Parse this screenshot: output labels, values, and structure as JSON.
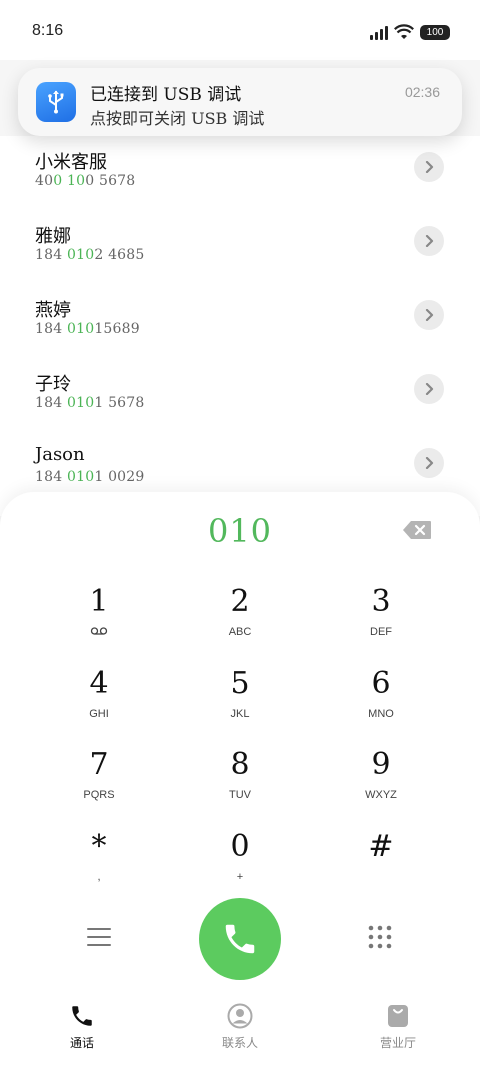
{
  "status": {
    "time": "8:16",
    "battery": "100"
  },
  "notification": {
    "title": "已连接到 USB 调试",
    "subtitle": "点按即可关闭 USB 调试",
    "time": "02:36",
    "icon": "usb-icon"
  },
  "contacts": [
    {
      "name": "小米客服",
      "num_pre": "40",
      "num_hl": "0 10",
      "num_post": "0 5678"
    },
    {
      "name": "雅娜",
      "num_pre": "184 ",
      "num_hl": "010",
      "num_post": "2 4685"
    },
    {
      "name": "燕婷",
      "num_pre": "184 ",
      "num_hl": "010",
      "num_post": "15689"
    },
    {
      "name": "子玲",
      "num_pre": "184 ",
      "num_hl": "010",
      "num_post": "1 5678"
    },
    {
      "name": "Jason",
      "num_pre": "184 ",
      "num_hl": "010",
      "num_post": "1 0029"
    }
  ],
  "dialer": {
    "number": "010",
    "keys": [
      {
        "digit": "1",
        "letters": ""
      },
      {
        "digit": "2",
        "letters": "ABC"
      },
      {
        "digit": "3",
        "letters": "DEF"
      },
      {
        "digit": "4",
        "letters": "GHI"
      },
      {
        "digit": "5",
        "letters": "JKL"
      },
      {
        "digit": "6",
        "letters": "MNO"
      },
      {
        "digit": "7",
        "letters": "PQRS"
      },
      {
        "digit": "8",
        "letters": "TUV"
      },
      {
        "digit": "9",
        "letters": "WXYZ"
      },
      {
        "digit": "*",
        "letters": ","
      },
      {
        "digit": "0",
        "letters": "+"
      },
      {
        "digit": "#",
        "letters": ""
      }
    ]
  },
  "tabs": [
    {
      "label": "通话",
      "icon": "phone-icon",
      "active": true
    },
    {
      "label": "联系人",
      "icon": "person-icon",
      "active": false
    },
    {
      "label": "营业厅",
      "icon": "shopping-bag-icon",
      "active": false
    }
  ],
  "colors": {
    "accent": "#52b85c",
    "call": "#5ccb5f"
  }
}
